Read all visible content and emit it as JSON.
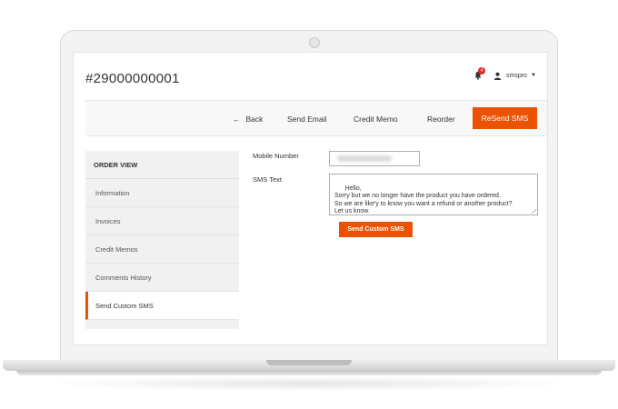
{
  "header": {
    "order_title": "#29000000001",
    "notifications_count": "4",
    "username": "smspro"
  },
  "actionbar": {
    "back_label": "Back",
    "send_email_label": "Send Email",
    "credit_memo_label": "Credit Memo",
    "reorder_label": "Reorder",
    "resend_sms_label": "ReSend SMS"
  },
  "sidebar": {
    "title": "ORDER VIEW",
    "items": [
      {
        "label": "Information"
      },
      {
        "label": "Invoices"
      },
      {
        "label": "Credit Memos"
      },
      {
        "label": "Comments History"
      },
      {
        "label": "Send Custom SMS"
      }
    ],
    "active_index": 4
  },
  "form": {
    "mobile_label": "Mobile Number",
    "sms_label": "SMS Text",
    "sms_text": "Hello,\nSorry but we no longer have the product you have ordered.\nSo we are like'y to know you want a refund or another product?\nLet us know.",
    "send_button_label": "Send Custom SMS"
  },
  "colors": {
    "accent": "#eb5202",
    "badge": "#e22626"
  },
  "icons": [
    "bell-icon",
    "user-icon",
    "back-arrow-icon",
    "resize-handle-icon"
  ]
}
